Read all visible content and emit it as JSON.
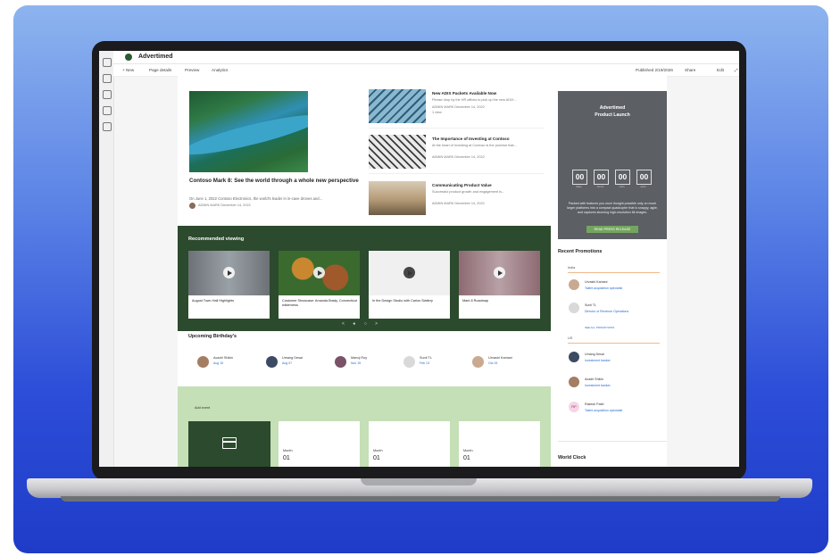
{
  "app": {
    "title": "Advertimed"
  },
  "command_bar": {
    "new": "+ New",
    "page_details": "Page details",
    "preview": "Preview",
    "analytics": "Analytics",
    "published": "Published 2/19/2026",
    "share": "Share",
    "edit": "Edit"
  },
  "hero": {
    "title": "Contoso Mark 8: See the world through a whole new perspective",
    "summary": "On June 1, 2022 Contoso Electronics, the world's leader in in-cave drones and...",
    "author": "ADMIN MARK",
    "date": "December 14, 2022"
  },
  "news": [
    {
      "title": "New ADIX Packets Available Now",
      "summary": "Please drop by the HR offices to pick up the new ADIX...",
      "author": "ADMIN MARK",
      "date": "December 14, 2022",
      "extra": "1 view"
    },
    {
      "title": "The Importance of Investing at Contoso",
      "summary": "At the heart of Investing at Contoso is the promise that...",
      "author": "ADMIN MARK",
      "date": "December 14, 2022",
      "extra": ""
    },
    {
      "title": "Communicating Product Value",
      "summary": "Successful product growth and engagement is...",
      "author": "ADMIN MARK",
      "date": "December 14, 2022",
      "extra": ""
    }
  ],
  "promo": {
    "brand": "Advertimed",
    "headline": "Product Launch",
    "countdown": [
      "00",
      "00",
      "00",
      "00"
    ],
    "countdown_units": [
      "days",
      "hours",
      "mins",
      "secs"
    ],
    "description": "Packed with features you once thought possible only on much larger platforms into a compact quadcopter that is snappy, agile, and captures stunning high-resolution 8k images.",
    "button": "READ PRESS RELEASE"
  },
  "recommended": {
    "title": "Recommended viewing",
    "videos": [
      {
        "label": "August Town Hall Highlights"
      },
      {
        "label": "Customer Showcase: Amanda Brady, Connecticut wilderness"
      },
      {
        "label": "In the Design Studio with Carlos Slattery"
      },
      {
        "label": "Mark 8 Roadmap"
      }
    ],
    "pager": "< ● ○ >"
  },
  "birthdays": {
    "title": "Upcoming Birthday's",
    "people": [
      {
        "name": "Acadri Shikin",
        "date": "Aug 15"
      },
      {
        "name": "Umang Desai",
        "date": "Aug 07"
      },
      {
        "name": "Manoj Roy",
        "date": "Nov 15"
      },
      {
        "name": "Sunil TL",
        "date": "Feb 13"
      },
      {
        "name": "Urvashi Kamani",
        "date": "Oct 15"
      }
    ]
  },
  "events": {
    "add": "Add event",
    "cards": [
      {
        "month": "Month",
        "day": "01"
      },
      {
        "month": "Month",
        "day": "01"
      },
      {
        "month": "Month",
        "day": "01"
      }
    ]
  },
  "promotions": {
    "title": "Recent Promotions",
    "groups": [
      {
        "name": "India",
        "items": [
          {
            "name": "Urvashi Kamani",
            "role": "Talent acquisition specialist"
          },
          {
            "name": "Sunil TL",
            "role": "Director of Revenue Operations"
          }
        ],
        "more": "SEE ALL PROMOTIONS"
      },
      {
        "name": "US",
        "items": [
          {
            "name": "Umang Desai",
            "role": "Investment banker"
          },
          {
            "name": "Acadri Shikin",
            "role": "Investment banker"
          },
          {
            "name": "Rakesh Patel",
            "role": "Talent acquisition specialist",
            "initials": "RP"
          }
        ]
      }
    ]
  },
  "world_clock": {
    "title": "World Clock"
  },
  "colors": {
    "accent_green": "#2c4a2d",
    "events_bg": "#c5dfb6",
    "link_blue": "#2a6bd0",
    "promo_grey": "#5c5f64"
  }
}
